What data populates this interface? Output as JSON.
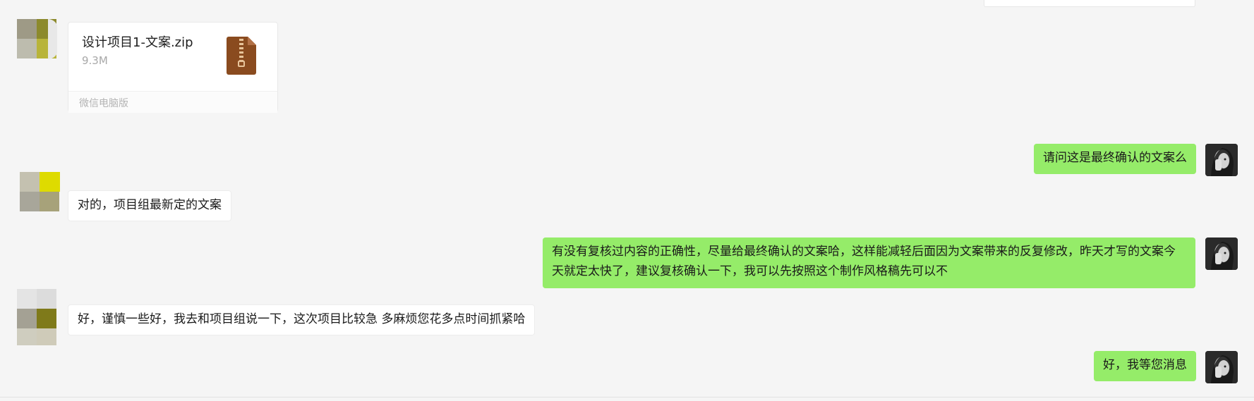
{
  "file_message": {
    "file_name": "设计项目1-文案.zip",
    "file_size": "9.3M",
    "source": "微信电脑版",
    "icon": "zip-file-icon"
  },
  "messages": [
    {
      "direction": "outgoing",
      "text": "请问这是最终确认的文案么"
    },
    {
      "direction": "incoming",
      "text": "对的，项目组最新定的文案"
    },
    {
      "direction": "outgoing",
      "text": "有没有复核过内容的正确性，尽量给最终确认的文案哈，这样能减轻后面因为文案带来的反复修改，昨天才写的文案今天就定太快了，建议复核确认一下，我可以先按照这个制作风格稿先可以不"
    },
    {
      "direction": "incoming",
      "text": "好，谨慎一些好，我去和项目组说一下，这次项目比较急 多麻烦您花多点时间抓紧哈"
    },
    {
      "direction": "outgoing",
      "text": "好，我等您消息"
    }
  ],
  "colors": {
    "background": "#f5f5f5",
    "outgoing_bubble": "#95ec69",
    "incoming_bubble": "#ffffff",
    "zip_icon": "#8a4b1f"
  }
}
